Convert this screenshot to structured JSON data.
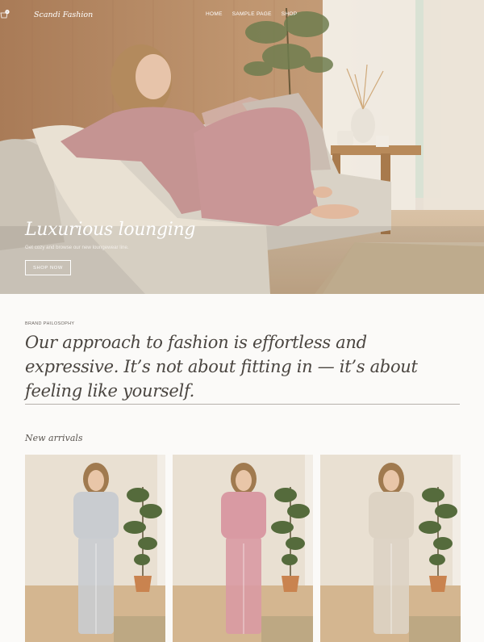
{
  "header": {
    "logo": "Scandi Fashion",
    "nav": [
      "HOME",
      "SAMPLE PAGE",
      "SHOP"
    ],
    "cart_count": "0"
  },
  "hero": {
    "title": "Luxurious lounging",
    "subtitle": "Get cozy and browse our new loungewear line.",
    "button_label": "SHOP NOW"
  },
  "philosophy": {
    "eyebrow": "BRAND PHILOSOPHY",
    "statement": "Our approach to fashion is effortless and expressive. It’s not about fitting in — it’s about feeling like yourself."
  },
  "new_arrivals": {
    "title": "New arrivals",
    "products": [
      {
        "color": "#c9ccd0"
      },
      {
        "color": "#d99aa3"
      },
      {
        "color": "#ddd3c4"
      }
    ]
  }
}
